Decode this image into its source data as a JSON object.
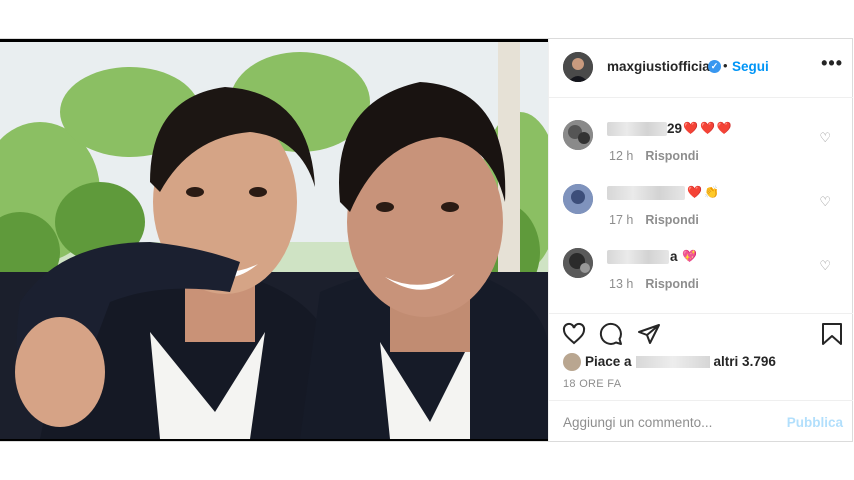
{
  "header": {
    "username": "maxgiustiofficial",
    "verified_icon": "✓",
    "separator": "•",
    "follow_label": "Segui",
    "more_label": "•••"
  },
  "comments": [
    {
      "username_visible": "29",
      "emoji": "❤️❤️❤️",
      "time": "12 h",
      "reply": "Rispondi"
    },
    {
      "username_visible": "",
      "emoji": "❤️👏",
      "time": "17 h",
      "reply": "Rispondi"
    },
    {
      "username_visible": "a",
      "emoji": "💖",
      "time": "13 h",
      "reply": "Rispondi"
    }
  ],
  "actions": {
    "likes_prefix": "Piace a",
    "likes_suffix": "altri 3.796",
    "posted": "18 ORE FA"
  },
  "comment_box": {
    "placeholder": "Aggiungi un commento...",
    "publish": "Pubblica"
  },
  "colors": {
    "accent": "#0095f6",
    "publish_disabled": "#b2dffc",
    "heart": "#e0245e",
    "muted": "#8e8e8e"
  }
}
